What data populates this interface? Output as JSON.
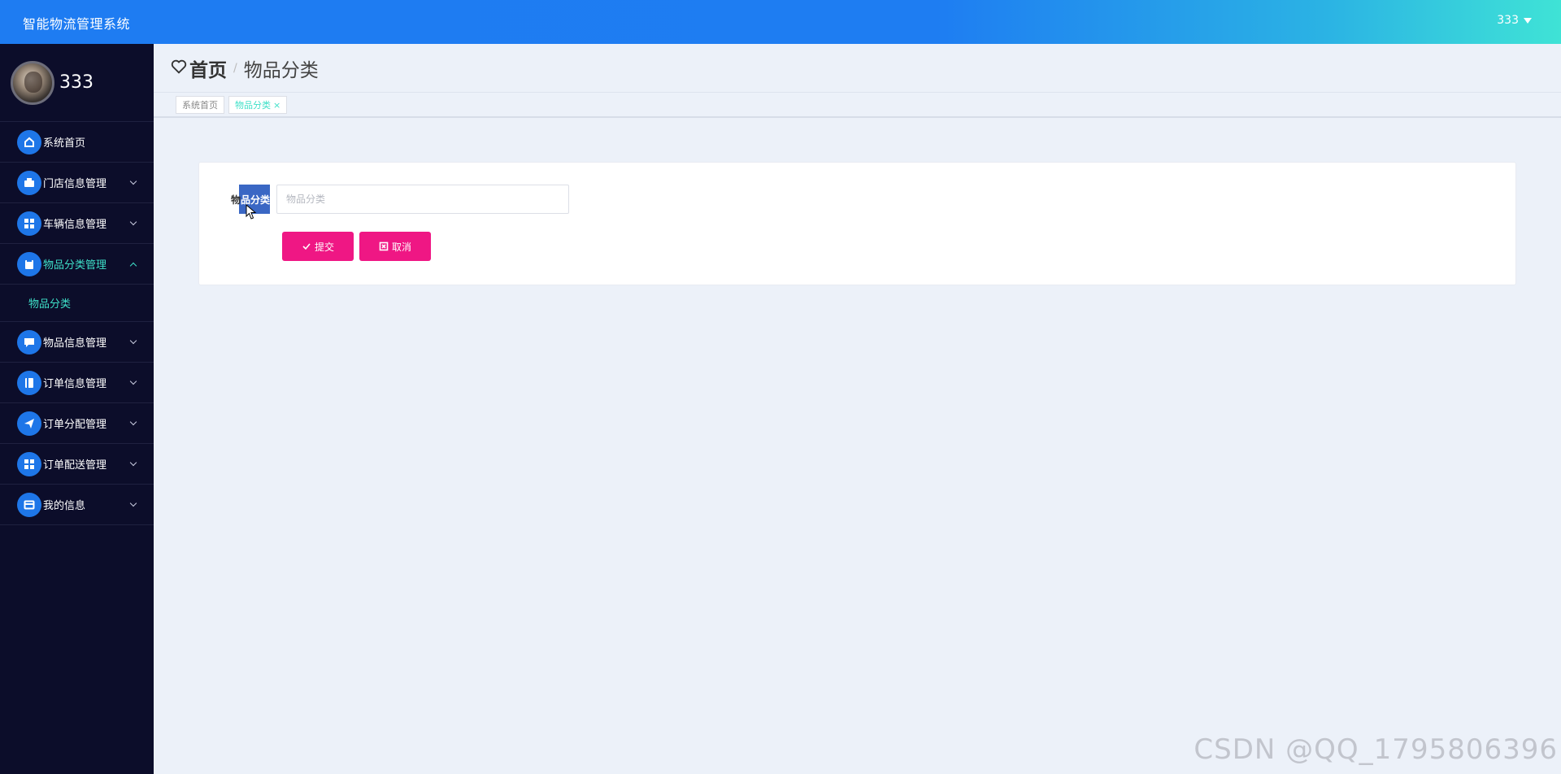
{
  "header": {
    "app_title": "智能物流管理系统",
    "user_label": "333"
  },
  "sidebar": {
    "profile_name": "333",
    "items": [
      {
        "label": "系统首页",
        "icon": "home-icon"
      },
      {
        "label": "门店信息管理",
        "icon": "briefcase-icon"
      },
      {
        "label": "车辆信息管理",
        "icon": "grid-icon"
      },
      {
        "label": "物品分类管理",
        "icon": "clipboard-icon",
        "open": true
      },
      {
        "label": "物品信息管理",
        "icon": "chat-icon"
      },
      {
        "label": "订单信息管理",
        "icon": "book-icon"
      },
      {
        "label": "订单分配管理",
        "icon": "send-icon"
      },
      {
        "label": "订单配送管理",
        "icon": "grid-icon"
      },
      {
        "label": "我的信息",
        "icon": "card-icon"
      }
    ],
    "submenu_label": "物品分类"
  },
  "breadcrumb": {
    "home": "首页",
    "separator": "/",
    "current": "物品分类"
  },
  "tabs": [
    {
      "label": "系统首页",
      "active": false
    },
    {
      "label": "物品分类",
      "active": true
    }
  ],
  "form": {
    "label_pre": "物",
    "label_hl": "品分类",
    "input_placeholder": "物品分类",
    "input_value": "",
    "submit_label": "提交",
    "cancel_label": "取消"
  },
  "watermark": "CSDN @QQ_1795806396",
  "colors": {
    "accent": "#3ee0c8",
    "primary_button": "#ef1784",
    "sidebar_bg": "#0c0d2a",
    "header_blue": "#1e7cf2"
  }
}
